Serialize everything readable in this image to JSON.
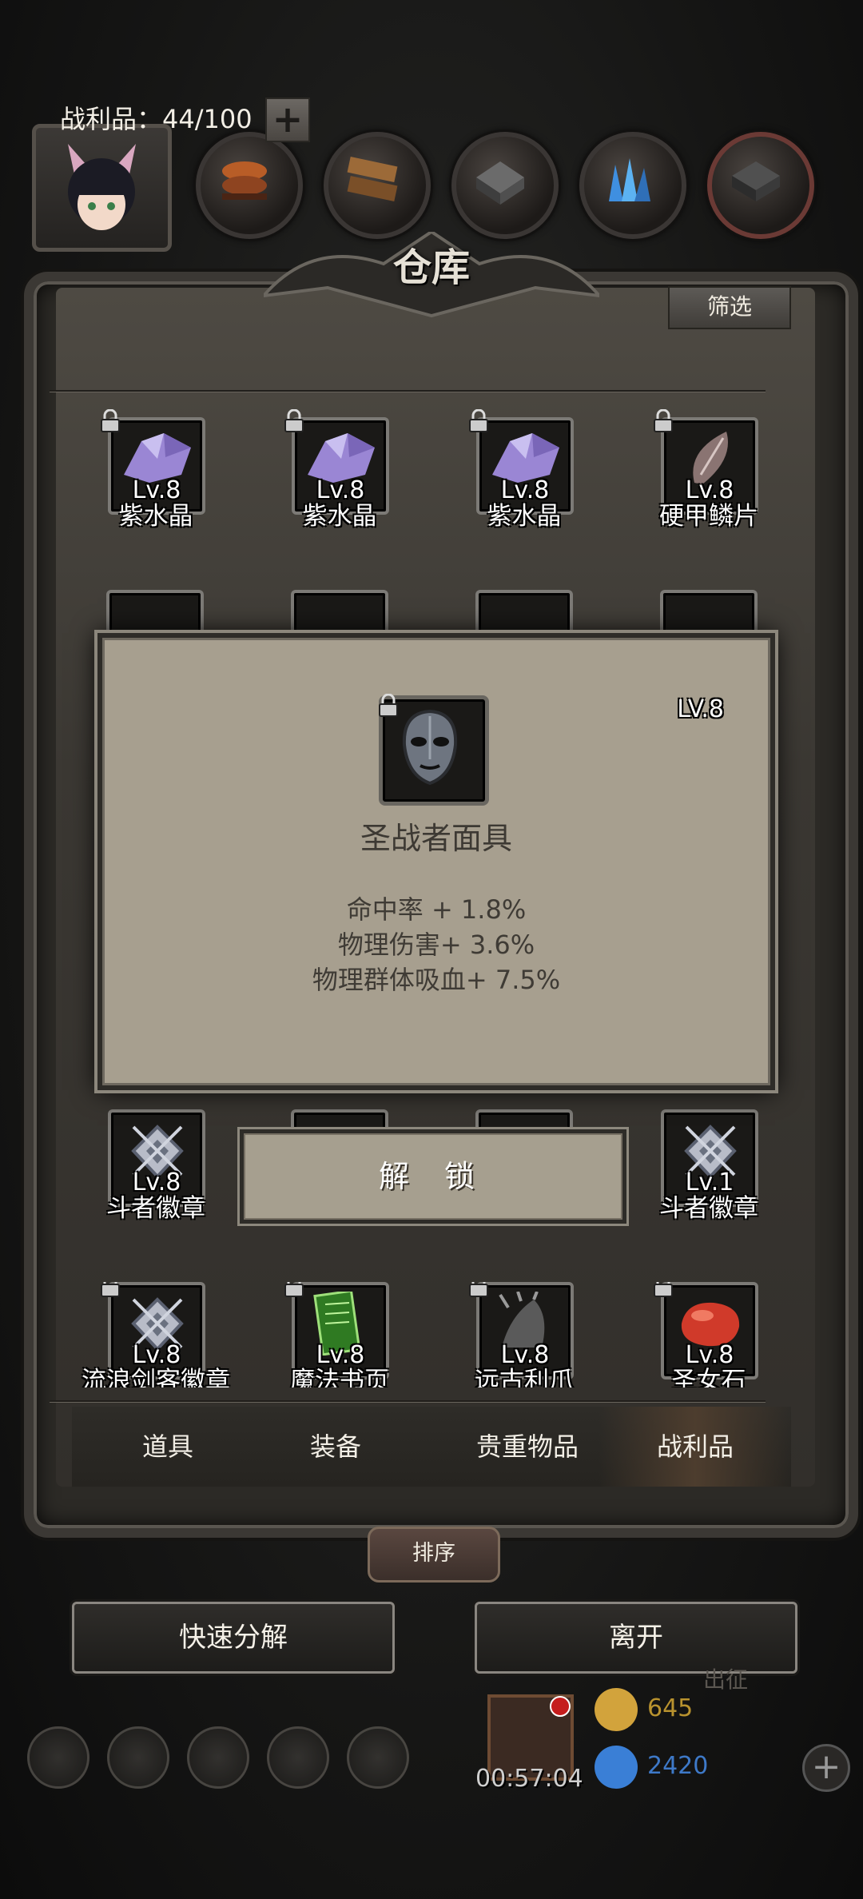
{
  "window": {
    "title": "仓库",
    "filter_label": "筛选"
  },
  "capacity": {
    "label": "战利品：44/100",
    "plus": "+"
  },
  "items": [
    {
      "name": "紫水晶",
      "level": "Lv.8",
      "icon": "amethyst-icon"
    },
    {
      "name": "紫水晶",
      "level": "Lv.8",
      "icon": "amethyst-icon"
    },
    {
      "name": "紫水晶",
      "level": "Lv.8",
      "icon": "amethyst-icon"
    },
    {
      "name": "硬甲鳞片",
      "level": "Lv.8",
      "icon": "scale-icon"
    },
    {
      "name": "斗者徽章",
      "level": "Lv.8",
      "icon": "badge-icon"
    },
    {
      "name": "斗者徽章",
      "level": "Lv.1",
      "icon": "badge-icon"
    },
    {
      "name": "流浪剑客徽章",
      "level": "Lv.8",
      "icon": "badge-icon"
    },
    {
      "name": "魔法书页",
      "level": "Lv.8",
      "icon": "spellbook-page-icon"
    },
    {
      "name": "远古利爪",
      "level": "Lv.8",
      "icon": "claw-icon"
    },
    {
      "name": "圣女石",
      "level": "Lv.8",
      "icon": "red-stone-icon"
    }
  ],
  "popup": {
    "level": "LV.8",
    "name": "圣战者面具",
    "icon": "mask-icon",
    "stats": [
      "命中率 + 1.8%",
      "物理伤害+ 3.6%",
      "物理群体吸血+ 7.5%"
    ],
    "unlock_label": "解 锁"
  },
  "tabs": [
    {
      "label": "道具",
      "active": false
    },
    {
      "label": "装备",
      "active": false
    },
    {
      "label": "贵重物品",
      "active": false
    },
    {
      "label": "战利品",
      "active": true
    }
  ],
  "sort_label": "排序",
  "buttons": {
    "quick_decompose": "快速分解",
    "leave": "离开"
  },
  "hud": {
    "timer": "00:57:04",
    "gold": "645",
    "gems": "2420",
    "plus": "+",
    "side_text": "出征"
  },
  "colors": {
    "gold": "#d2a33c",
    "gem": "#3a7fd6",
    "panel": "#a79f8f"
  }
}
